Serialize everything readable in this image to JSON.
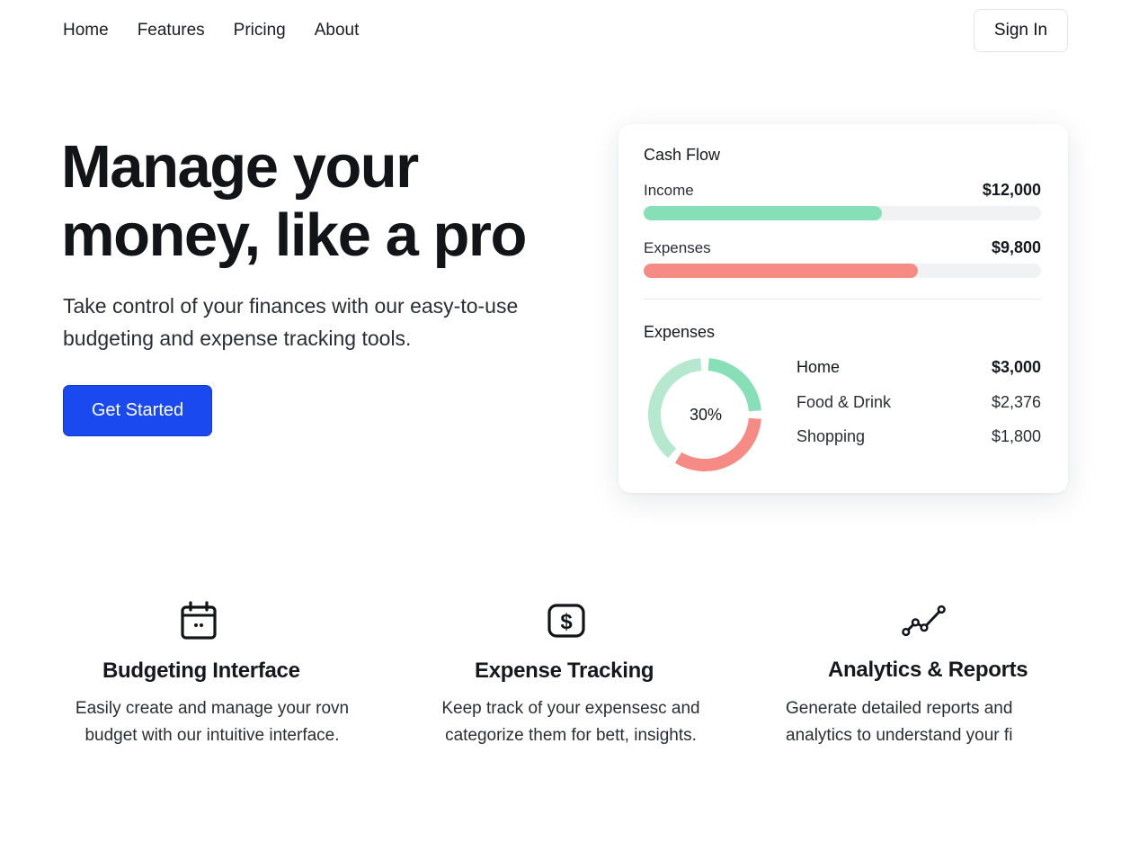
{
  "nav": {
    "links": [
      "Home",
      "Features",
      "Pricing",
      "About"
    ],
    "signin_label": "Sign In"
  },
  "hero": {
    "title_line1": "Manage your",
    "title_line2": "money, like a pro",
    "subtitle": "Take control of your finances with our easy-to-use budgeting and expense tracking tools.",
    "cta_label": "Get Started"
  },
  "card": {
    "cash_flow_title": "Cash Flow",
    "income": {
      "label": "Income",
      "value": "$12,000",
      "fill_fraction": 0.6,
      "color": "#86dfb6"
    },
    "expenses": {
      "label": "Expenses",
      "value": "$9,800",
      "fill_fraction": 0.69,
      "color": "#f68b85"
    },
    "expenses_title": "Expenses",
    "donut": {
      "center_label": "30%",
      "segments": [
        {
          "name": "Home",
          "fraction": 0.25,
          "color": "#86dfb6"
        },
        {
          "name": "Food & Drink",
          "fraction": 0.35,
          "color": "#f68b85"
        },
        {
          "name": "Shopping",
          "fraction": 0.4,
          "color": "#b6e8cf"
        }
      ]
    },
    "legend": [
      {
        "name": "Home",
        "value": "$3,000"
      },
      {
        "name": "Food & Drink",
        "value": "$2,376"
      },
      {
        "name": "Shopping",
        "value": "$1,800"
      }
    ]
  },
  "features": [
    {
      "icon": "calendar-icon",
      "title": "Budgeting Interface",
      "desc": "Easily create and manage your rovn budget with our intuitive interface."
    },
    {
      "icon": "dollar-icon",
      "title": "Expense Tracking",
      "desc": "Keep track of your expensesc and categorize them for bett, insights."
    },
    {
      "icon": "analytics-icon",
      "title": "Analytics & Reports",
      "desc": "Generate detailed reports and analytics to understand your fi"
    }
  ],
  "colors": {
    "accent": "#1a49f0",
    "income": "#86dfb6",
    "expense": "#f68b85",
    "text": "#111418"
  }
}
